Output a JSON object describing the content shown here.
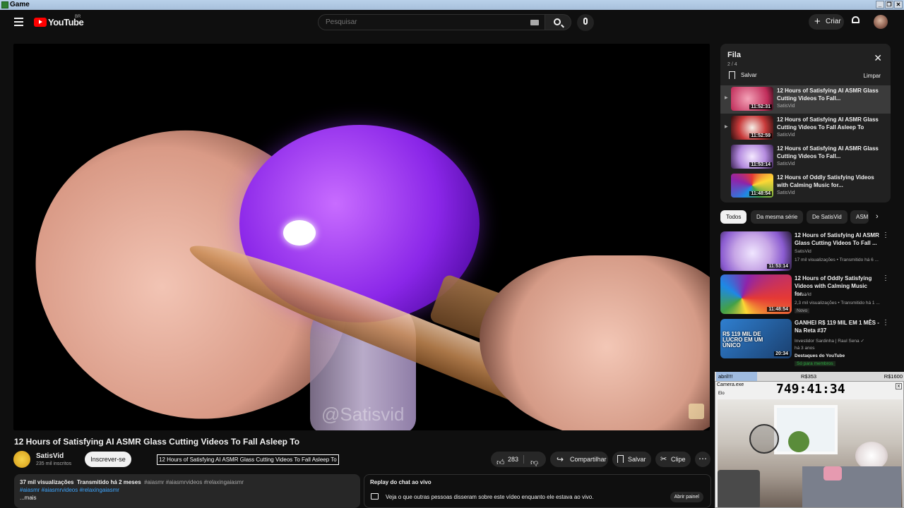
{
  "window": {
    "title": "Game",
    "buttons": [
      "_",
      "❐",
      "✕"
    ]
  },
  "topbar": {
    "logo_text": "YouTube",
    "country": "BR",
    "search_placeholder": "Pesquisar",
    "create_label": "Criar"
  },
  "video": {
    "watermark": "@Satisvid",
    "title": "12 Hours of Satisfying AI ASMR Glass Cutting Videos To Fall Asleep To",
    "tooltip": "12 Hours of Satisfying AI ASMR Glass Cutting Videos To Fall Asleep To",
    "channel": "SatisVid",
    "subscribers": "235 mil inscritos",
    "subscribe_label": "Inscrever-se",
    "likes": "283",
    "share_label": "Compartilhar",
    "save_label": "Salvar",
    "clip_label": "Clipe"
  },
  "description": {
    "views": "37 mil visualizações",
    "streamed": "Transmitido há 2 meses",
    "tags_inline": "#aiasmr #aiasmrvideos #relaxingaiasmr",
    "hashtags": "#aiasmr #aiasmrvideos #relaxingaiasmr",
    "more": "...mais"
  },
  "chat_replay": {
    "title": "Replay do chat ao vivo",
    "description": "Veja o que outras pessoas disseram sobre este vídeo enquanto ele estava ao vivo.",
    "open_label": "Abrir painel"
  },
  "queue": {
    "title": "Fila",
    "position": "2 / 4",
    "save_label": "Salvar",
    "clear_label": "Limpar",
    "items": [
      {
        "title": "12 Hours of Satisfying AI ASMR Glass Cutting Videos To Fall...",
        "channel": "SatisVid",
        "duration": "11:52:31",
        "color": "#e0567a"
      },
      {
        "title": "12 Hours of Satisfying AI ASMR Glass Cutting Videos To Fall Asleep To",
        "channel": "SatisVid",
        "duration": "11:52:59",
        "color": "#c83a3a"
      },
      {
        "title": "12 Hours of Satisfying AI ASMR Glass Cutting Videos To Fall...",
        "channel": "SatisVid",
        "duration": "11:53:14",
        "color": "#c7a6e6"
      },
      {
        "title": "12 Hours of Oddly Satisfying Videos with Calming Music for...",
        "channel": "SatisVid",
        "duration": "11:48:54",
        "color": "#3fb7c9"
      }
    ]
  },
  "chips": [
    "Todos",
    "Da mesma série",
    "De SatisVid",
    "ASMR"
  ],
  "recommendations": [
    {
      "title": "12 Hours of Satisfying AI ASMR Glass Cutting Videos To Fall ...",
      "channel": "SatisVid",
      "meta": "17 mil visualizações • Transmitido há 6 ...",
      "duration": "11:53:14",
      "badge": "",
      "members": ""
    },
    {
      "title": "12 Hours of Oddly Satisfying Videos with Calming Music for...",
      "channel": "SatisVid",
      "meta": "2,3 mil visualizações • Transmitido há 1 ...",
      "duration": "11:48:54",
      "badge": "Novo",
      "members": ""
    },
    {
      "title": "GANHEI R$ 119 MIL EM 1 MÊS - Na Reta #37",
      "channel": "Investidor Sardinha | Raul Sena ✓",
      "meta": "há 3 anos",
      "duration": "20:34",
      "badge": "Destaques do YouTube",
      "members": "Só para membros",
      "thumb_text": "R$ 119 MIL DE LUCRO EM UM ÚNICO"
    }
  ],
  "overlay": {
    "status_left": "abril!!!",
    "status_mid": "R$353",
    "status_right": "R$1600",
    "camera_title": "Camera.exe",
    "camera_label": "Elo",
    "timer": "749:41:34"
  }
}
